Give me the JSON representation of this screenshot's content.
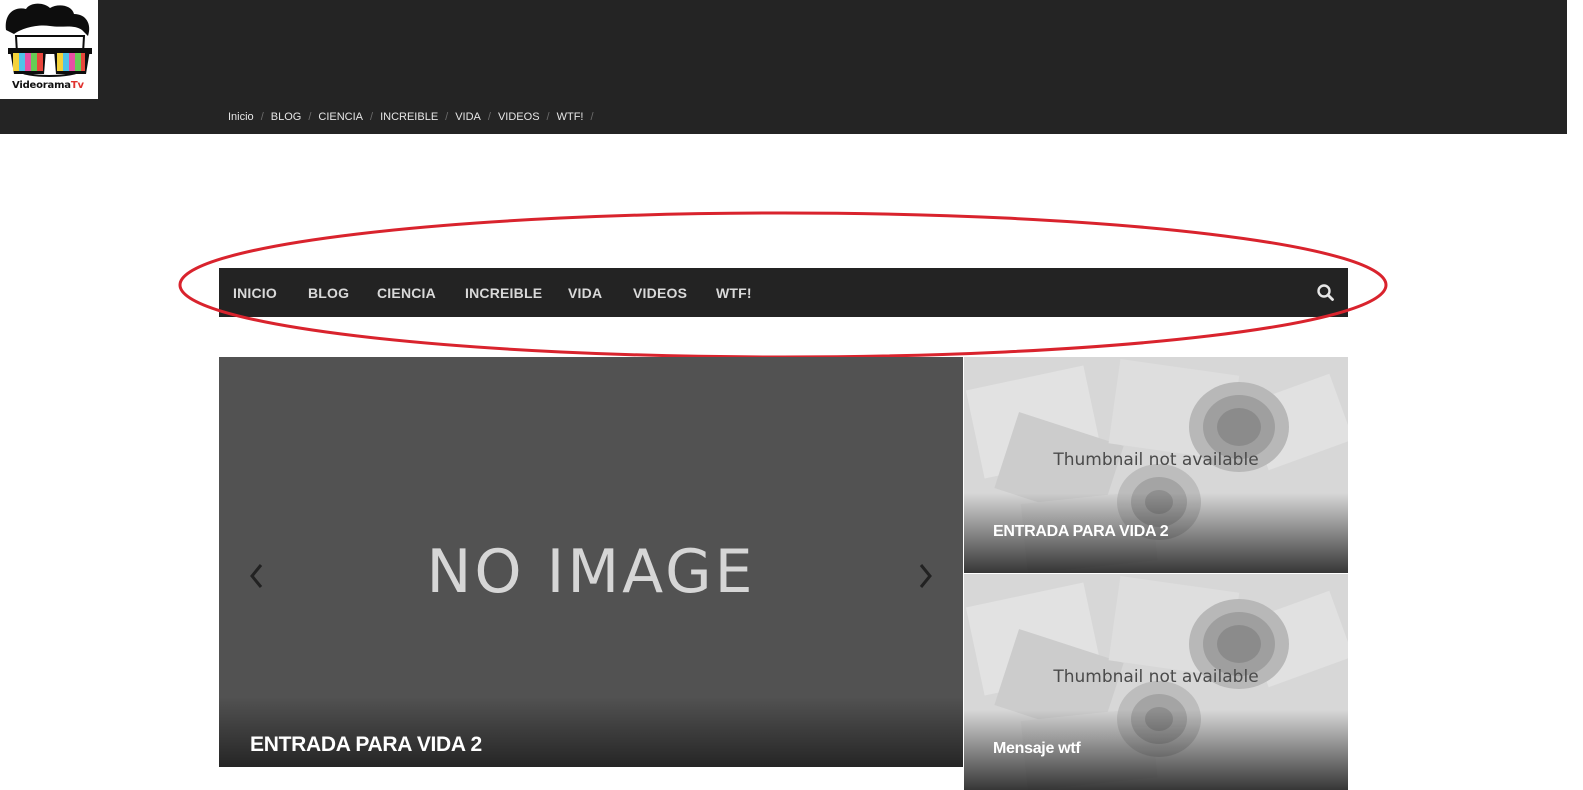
{
  "logo": {
    "brand_main": "Videorama",
    "brand_accent": "Tv"
  },
  "breadcrumb": [
    "Inicio",
    "BLOG",
    "CIENCIA",
    "INCREIBLE",
    "VIDA",
    "VIDEOS",
    "WTF!"
  ],
  "main_nav": {
    "items": [
      "INICIO",
      "BLOG",
      "CIENCIA",
      "INCREIBLE",
      "VIDA",
      "VIDEOS",
      "WTF!"
    ],
    "search_icon": "search-icon"
  },
  "slider": {
    "placeholder": "NO IMAGE",
    "title": "ENTRADA PARA VIDA 2",
    "prev_icon": "chevron-left-icon",
    "next_icon": "chevron-right-icon"
  },
  "side_posts": [
    {
      "thumb_text": "Thumbnail not available",
      "title": "ENTRADA PARA VIDA 2"
    },
    {
      "thumb_text": "Thumbnail not available",
      "title": "Mensaje wtf"
    }
  ],
  "colors": {
    "header_bg": "#242424",
    "nav_bg": "#232323",
    "slider_bg": "#525252",
    "highlight": "#d9232d"
  }
}
